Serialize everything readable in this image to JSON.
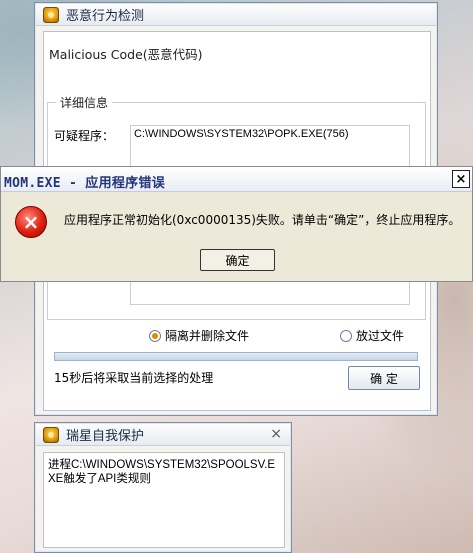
{
  "main_window": {
    "title": "恶意行为检测",
    "malicious_label": "Malicious Code(恶意代码)",
    "details_group": "详细信息",
    "suspicious_label": "可疑程序：",
    "suspicious_value": "C:\\WINDOWS\\SYSTEM32\\POPK.EXE(756)",
    "options": [
      {
        "label": "隔离并删除文件",
        "selected": true
      },
      {
        "label": "放过文件",
        "selected": false
      }
    ],
    "countdown_text": "15秒后将采取当前选择的处理",
    "confirm_label": "确 定"
  },
  "error_dialog": {
    "title": "MOM.EXE - 应用程序错误",
    "close_glyph": "×",
    "icon_glyph": "×",
    "message": "应用程序正常初始化(0xc0000135)失败。请单击“确定”，终止应用程序。",
    "ok_label": "确定"
  },
  "protect_window": {
    "title": "瑞星自我保护",
    "close_glyph": "×",
    "message": "进程C:\\WINDOWS\\SYSTEM32\\SPOOLSV.EXE触发了API类规则"
  },
  "colors": {
    "accent_orange": "#e08a00",
    "error_red": "#e02010",
    "title_blue": "#23367a"
  }
}
